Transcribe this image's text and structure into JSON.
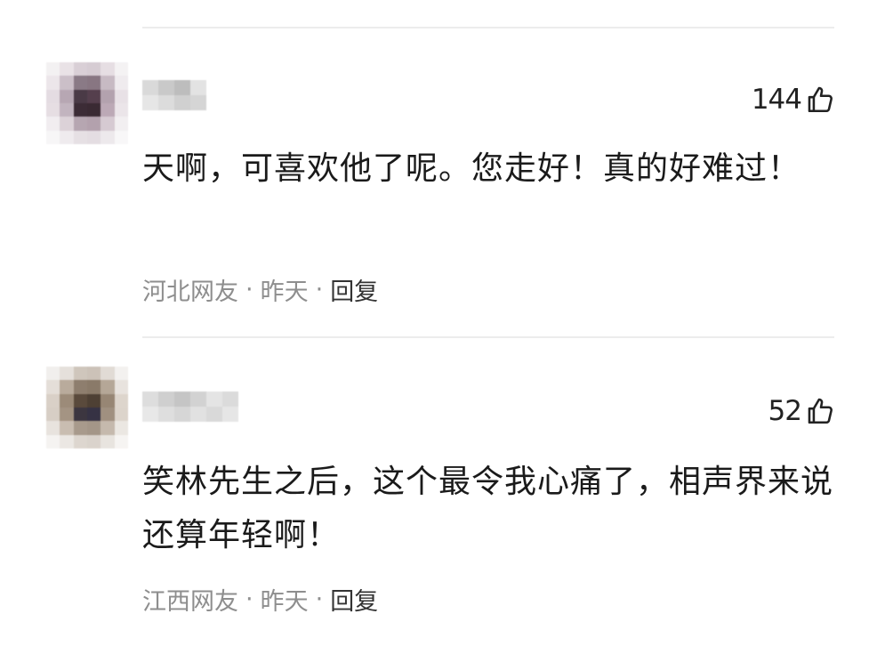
{
  "comments": [
    {
      "username": "",
      "likes": "144",
      "content": "天啊，可喜欢他了呢。您走好！真的好难过！",
      "location": "河北网友",
      "separator1": "·",
      "time": "昨天",
      "separator2": "·",
      "reply_label": "回复"
    },
    {
      "username": "",
      "likes": "52",
      "content": "笑林先生之后，这个最令我心痛了，相声界来说还算年轻啊！",
      "location": "江西网友",
      "separator1": "·",
      "time": "昨天",
      "separator2": "·",
      "reply_label": "回复"
    }
  ],
  "icons": {
    "like": "thumbs-up-icon"
  },
  "colors": {
    "text": "#1a1a1a",
    "meta": "#8e8e8e",
    "divider": "#ececec"
  }
}
